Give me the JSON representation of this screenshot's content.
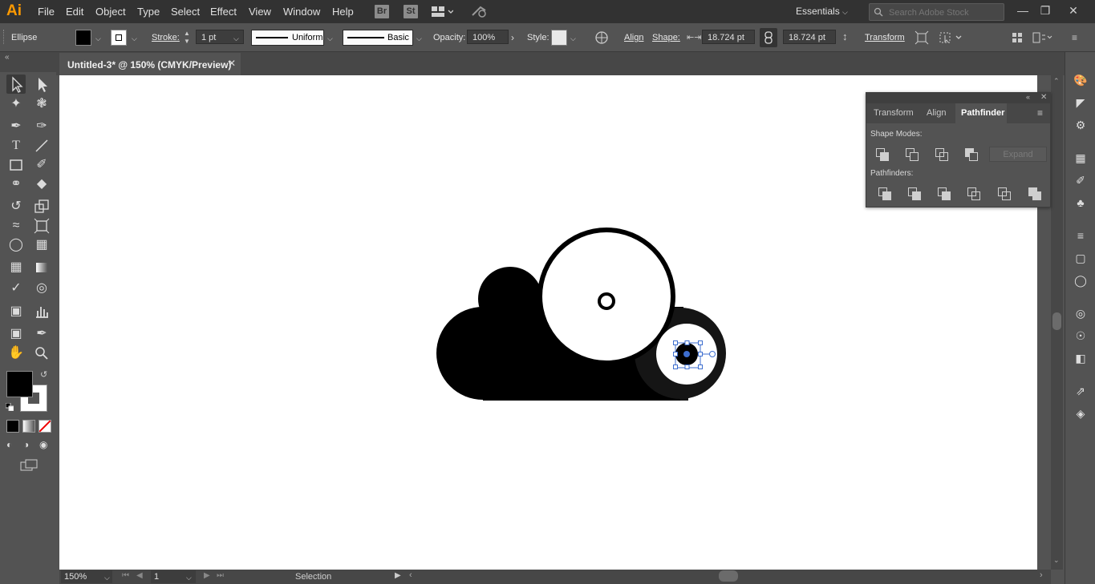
{
  "app": {
    "logo": "Ai"
  },
  "menu": [
    "File",
    "Edit",
    "Object",
    "Type",
    "Select",
    "Effect",
    "View",
    "Window",
    "Help"
  ],
  "menubar_icons": {
    "bridge": "Br",
    "stock": "St"
  },
  "workspace": "Essentials",
  "search": {
    "placeholder": "Search Adobe Stock"
  },
  "control_bar": {
    "selection_type": "Ellipse",
    "stroke_label": "Stroke:",
    "stroke_weight": "1 pt",
    "profile": "Uniform",
    "brush": "Basic",
    "opacity_label": "Opacity:",
    "opacity_value": "100%",
    "style_label": "Style:",
    "align_label": "Align",
    "shape_label": "Shape:",
    "width_value": "18.724 pt",
    "height_value": "18.724 pt",
    "transform_label": "Transform"
  },
  "document": {
    "tab_title": "Untitled-3* @ 150% (CMYK/Preview)"
  },
  "status": {
    "zoom": "150%",
    "page": "1",
    "tool": "Selection"
  },
  "pathfinder_panel": {
    "tabs": [
      "Transform",
      "Align",
      "Pathfinder"
    ],
    "active_tab": "Pathfinder",
    "shape_modes_label": "Shape Modes:",
    "pathfinders_label": "Pathfinders:",
    "expand_label": "Expand"
  },
  "colors": {
    "fill": "#000000",
    "stroke": "#ffffff",
    "accent": "#ff9a00",
    "selection": "#3d6ecf"
  }
}
